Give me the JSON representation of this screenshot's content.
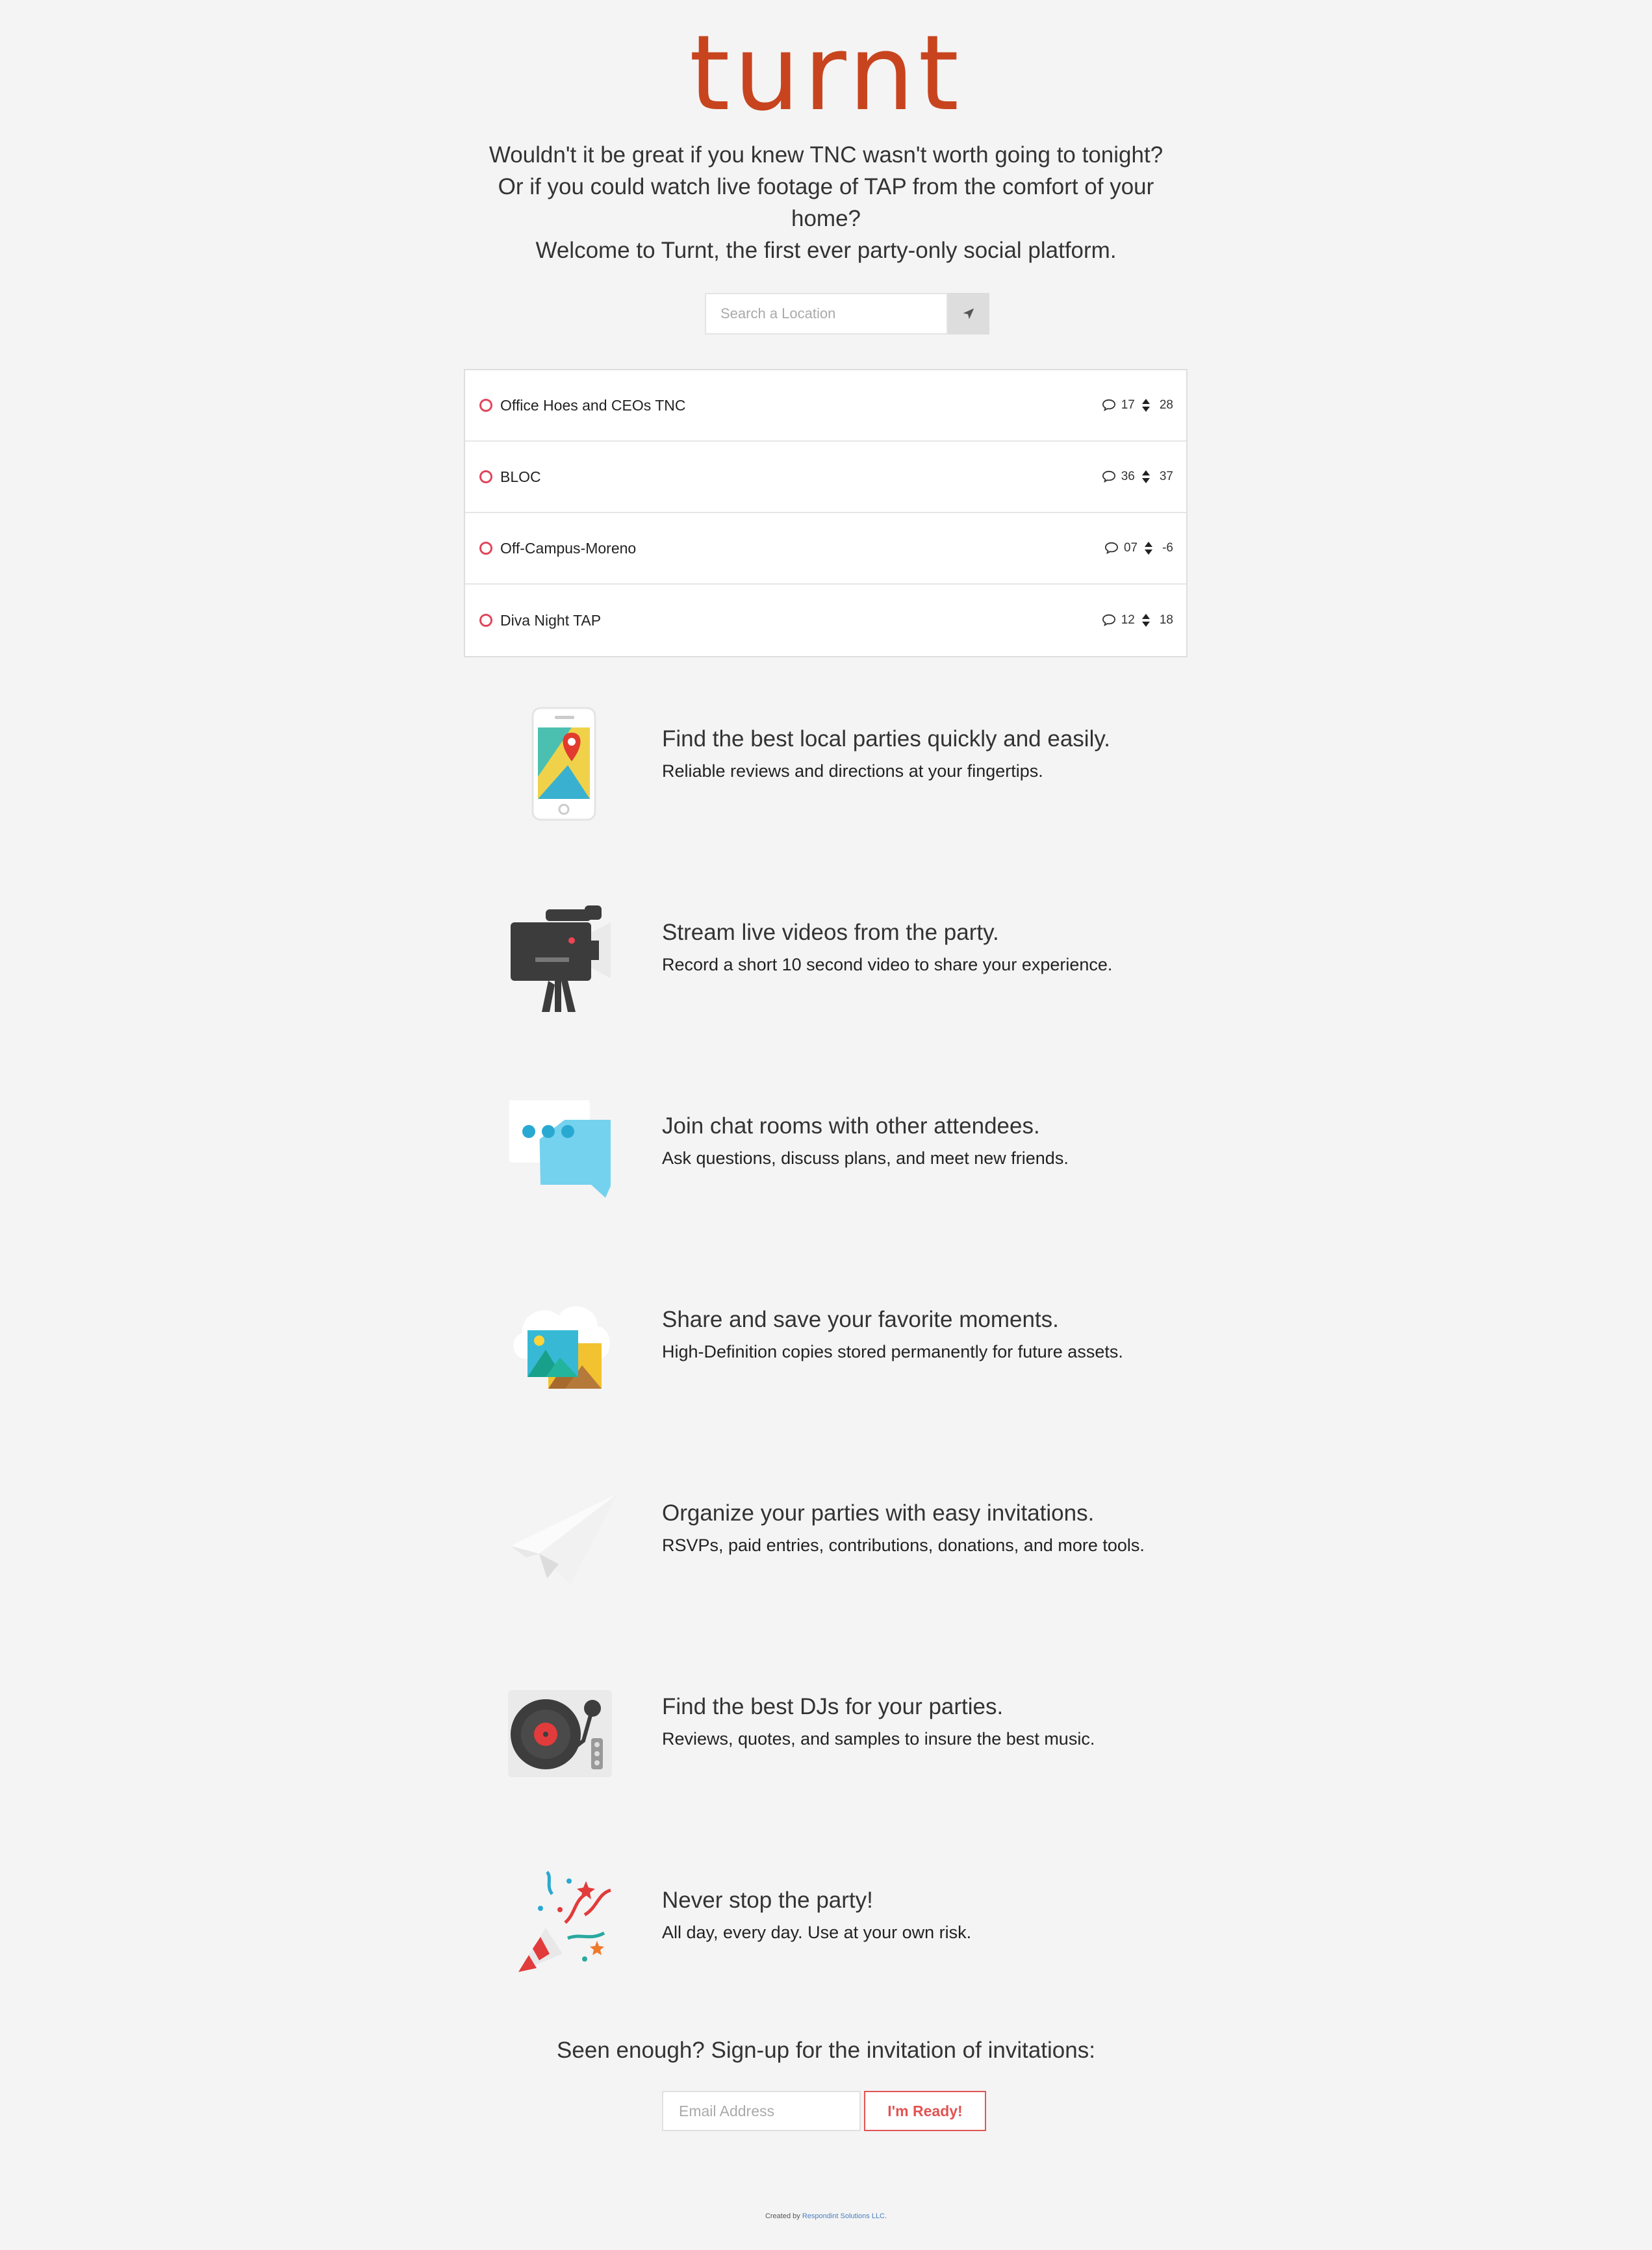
{
  "brand": {
    "logo": "turnt",
    "color": "#c8441e"
  },
  "intro": {
    "line1": "Wouldn't it be great if you knew TNC wasn't worth going to tonight?",
    "line2": "Or if you could watch live footage of TAP from the comfort of your home?",
    "line3": "Welcome to Turnt, the first ever party-only social platform."
  },
  "search": {
    "placeholder": "Search a Location",
    "button_icon": "location-arrow-icon"
  },
  "parties": [
    {
      "name": "Office Hoes and CEOs TNC",
      "comments": "17",
      "votes": "28"
    },
    {
      "name": "BLOC",
      "comments": "36",
      "votes": "37"
    },
    {
      "name": "Off-Campus-Moreno",
      "comments": "07",
      "votes": "-6"
    },
    {
      "name": "Diva Night TAP",
      "comments": "12",
      "votes": "18"
    }
  ],
  "features": [
    {
      "icon": "phone-map-icon",
      "title": "Find the best local parties quickly and easily.",
      "sub": "Reliable reviews and directions at your fingertips."
    },
    {
      "icon": "video-camera-icon",
      "title": "Stream live videos from the party.",
      "sub": "Record a short 10 second video to share your experience."
    },
    {
      "icon": "chat-bubbles-icon",
      "title": "Join chat rooms with other attendees.",
      "sub": "Ask questions, discuss plans, and meet new friends."
    },
    {
      "icon": "cloud-photos-icon",
      "title": "Share and save your favorite moments.",
      "sub": "High-Definition copies stored permanently for future assets."
    },
    {
      "icon": "paper-plane-icon",
      "title": "Organize your parties with easy invitations.",
      "sub": "RSVPs, paid entries, contributions, donations, and more tools."
    },
    {
      "icon": "turntable-icon",
      "title": "Find the best DJs for your parties.",
      "sub": "Reviews, quotes, and samples to insure the best music."
    },
    {
      "icon": "party-popper-icon",
      "title": "Never stop the party!",
      "sub": "All day, every day. Use at your own risk."
    }
  ],
  "signup": {
    "title": "Seen enough? Sign-up for the invitation of invitations:",
    "email_placeholder": "Email Address",
    "button_label": "I'm Ready!"
  },
  "footer": {
    "prefix": "Created by",
    "link": "Respondint Solutions LLC."
  }
}
